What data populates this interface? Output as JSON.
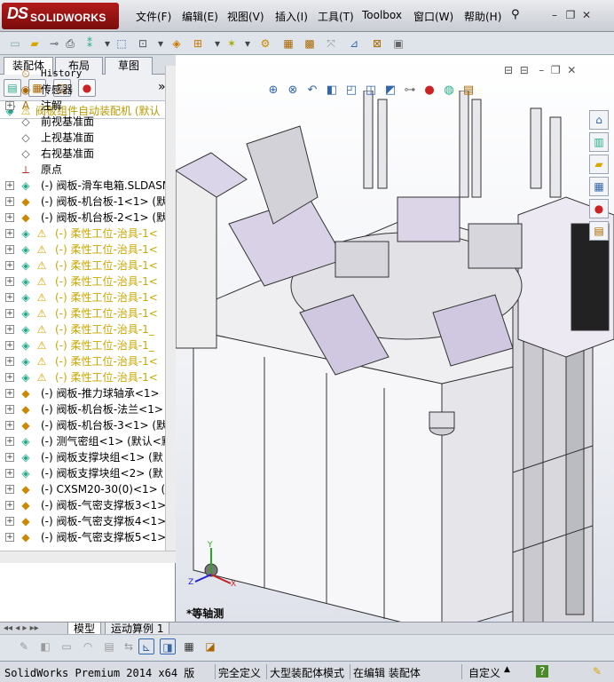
{
  "app": {
    "logo_ds": "DS",
    "logo_text": "SOLIDWORKS"
  },
  "menu": [
    "文件(F)",
    "编辑(E)",
    "视图(V)",
    "插入(I)",
    "工具(T)",
    "Toolbox",
    "窗口(W)",
    "帮助(H)"
  ],
  "panel": {
    "tabs": [
      "装配体",
      "布局",
      "草图"
    ],
    "active_tab": "装配体",
    "expand_glyph": "»"
  },
  "tree": {
    "root": "阀板组件自动装配机  (默认",
    "items": [
      {
        "label": "History",
        "icon": "history-icon",
        "mono": true
      },
      {
        "label": "传感器",
        "icon": "sensor-icon"
      },
      {
        "label": "注解",
        "icon": "annotation-icon",
        "expand": true
      },
      {
        "label": "前视基准面",
        "icon": "plane-icon"
      },
      {
        "label": "上视基准面",
        "icon": "plane-icon"
      },
      {
        "label": "右视基准面",
        "icon": "plane-icon"
      },
      {
        "label": "原点",
        "icon": "origin-icon"
      },
      {
        "label": "(-) 阀板-滑车电箱.SLDASM",
        "icon": "assembly-icon",
        "expand": true
      },
      {
        "label": "(-) 阀板-机台板-1<1> (默",
        "icon": "part-icon",
        "expand": true
      },
      {
        "label": "(-) 阀板-机台板-2<1> (默",
        "icon": "part-icon",
        "expand": true
      },
      {
        "label": "(-) 柔性工位-治具-1<",
        "icon": "assembly-icon",
        "expand": true,
        "warn": true
      },
      {
        "label": "(-) 柔性工位-治具-1<",
        "icon": "assembly-icon",
        "expand": true,
        "warn": true
      },
      {
        "label": "(-) 柔性工位-治具-1<",
        "icon": "assembly-icon",
        "expand": true,
        "warn": true
      },
      {
        "label": "(-) 柔性工位-治具-1<",
        "icon": "assembly-icon",
        "expand": true,
        "warn": true
      },
      {
        "label": "(-) 柔性工位-治具-1<",
        "icon": "assembly-icon",
        "expand": true,
        "warn": true
      },
      {
        "label": "(-) 柔性工位-治具-1<",
        "icon": "assembly-icon",
        "expand": true,
        "warn": true
      },
      {
        "label": "(-) 柔性工位-治具-1_",
        "icon": "assembly-icon",
        "expand": true,
        "warn": true
      },
      {
        "label": "(-) 柔性工位-治具-1_",
        "icon": "assembly-icon",
        "expand": true,
        "warn": true
      },
      {
        "label": "(-) 柔性工位-治具-1<",
        "icon": "assembly-icon",
        "expand": true,
        "warn": true
      },
      {
        "label": "(-) 柔性工位-治具-1<",
        "icon": "assembly-icon",
        "expand": true,
        "warn": true
      },
      {
        "label": "(-) 阀板-推力球轴承<1>",
        "icon": "part-icon",
        "expand": true
      },
      {
        "label": "(-) 阀板-机台板-法兰<1>",
        "icon": "part-icon",
        "expand": true
      },
      {
        "label": "(-) 阀板-机台板-3<1> (默",
        "icon": "part-icon",
        "expand": true
      },
      {
        "label": "(-) 测气密组<1> (默认<默",
        "icon": "assembly-icon",
        "expand": true
      },
      {
        "label": "(-) 阀板支撑块组<1> (默",
        "icon": "assembly-icon",
        "expand": true
      },
      {
        "label": "(-) 阀板支撑块组<2> (默",
        "icon": "assembly-icon",
        "expand": true
      },
      {
        "label": "(-) CXSM20-30(0)<1> (默",
        "icon": "part-icon",
        "expand": true
      },
      {
        "label": "(-) 阀板-气密支撑板3<1>",
        "icon": "part-icon",
        "expand": true
      },
      {
        "label": "(-) 阀板-气密支撑板4<1>",
        "icon": "part-icon",
        "expand": true
      },
      {
        "label": "(-) 阀板-气密支撑板5<1>",
        "icon": "part-icon",
        "expand": true
      }
    ]
  },
  "viewport": {
    "view_label": "*等轴测",
    "triad": {
      "x": "X",
      "y": "Y",
      "z": "Z"
    }
  },
  "bottom_tabs": [
    "模型",
    "运动算例 1"
  ],
  "status": {
    "version": "SolidWorks Premium 2014 x64 版",
    "s1": "完全定义",
    "s2": "大型装配体模式",
    "s3": "在编辑 装配体",
    "s4": "自定义",
    "help": "?"
  },
  "colors": {
    "warning": "#d9a400",
    "flexible_text": "#c9a800",
    "viewport_bg": "#f2f3f7"
  }
}
